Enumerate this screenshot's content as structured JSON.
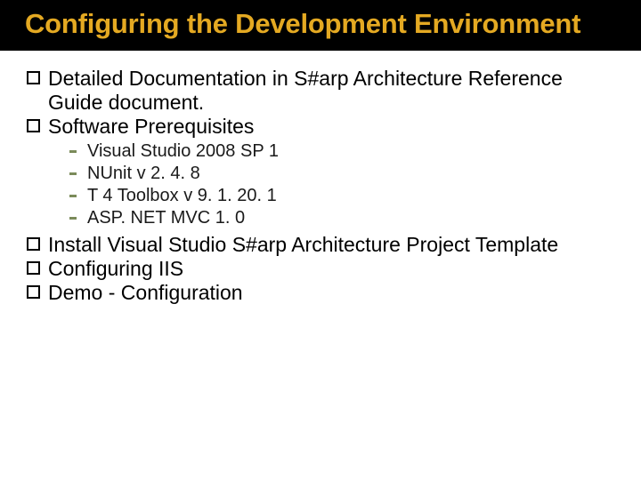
{
  "title": "Configuring the Development Environment",
  "bullets": {
    "b1": "Detailed Documentation in S#arp Architecture Reference Guide document.",
    "b2": "Software Prerequisites",
    "b2_sub": {
      "s1": "Visual Studio 2008 SP 1",
      "s2": "NUnit v 2. 4. 8",
      "s3": "T 4 Toolbox v 9. 1. 20. 1",
      "s4": "ASP. NET MVC 1. 0"
    },
    "b3": "Install Visual Studio S#arp Architecture Project Template",
    "b4": "Configuring IIS",
    "b5": "Demo - Configuration"
  }
}
